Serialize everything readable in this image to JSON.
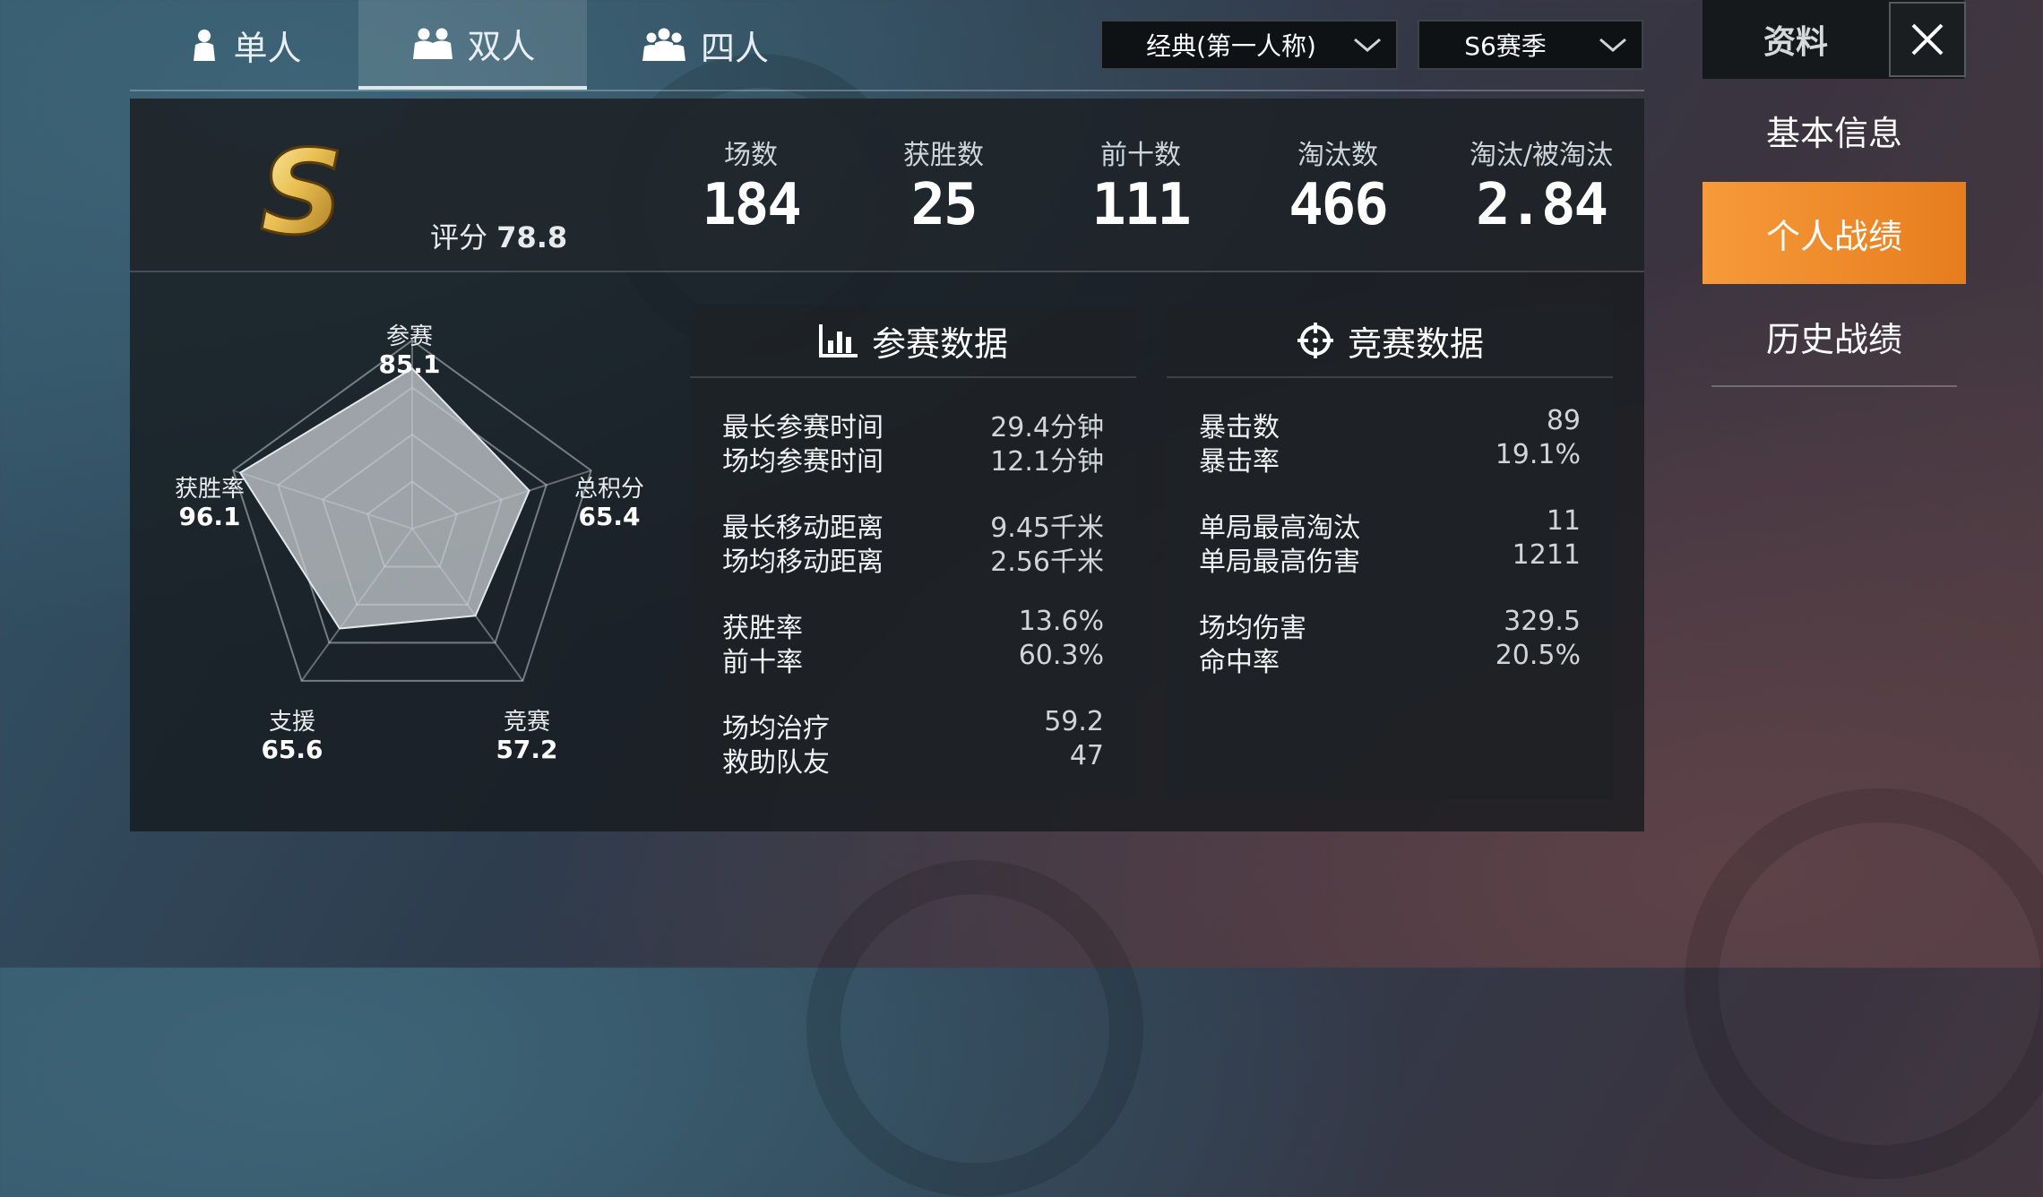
{
  "tabs": [
    {
      "label": "单人",
      "icon": "single-person-icon"
    },
    {
      "label": "双人",
      "icon": "duo-icon",
      "active": true
    },
    {
      "label": "四人",
      "icon": "squad-icon"
    }
  ],
  "filters": {
    "mode": "经典(第一人称)",
    "season": "S6赛季"
  },
  "right_panel": {
    "title": "资料",
    "nav": [
      "基本信息",
      "个人战绩",
      "历史战绩"
    ],
    "active_index": 1,
    "accent": "#f08a2c"
  },
  "summary": {
    "rank_letter": "S",
    "rating_label": "评分",
    "rating_value": "78.8",
    "stats": [
      {
        "label": "场数",
        "value": "184"
      },
      {
        "label": "获胜数",
        "value": "25"
      },
      {
        "label": "前十数",
        "value": "111"
      },
      {
        "label": "淘汰数",
        "value": "466"
      },
      {
        "label": "淘汰/被淘汰",
        "value": "2.84"
      }
    ]
  },
  "radar": {
    "axes": [
      {
        "label": "参赛",
        "value": "85.1",
        "score": 85.1
      },
      {
        "label": "总积分",
        "value": "65.4",
        "score": 65.4
      },
      {
        "label": "竞赛",
        "value": "57.2",
        "score": 57.2
      },
      {
        "label": "支援",
        "value": "65.6",
        "score": 65.6
      },
      {
        "label": "获胜率",
        "value": "96.1",
        "score": 96.1
      }
    ]
  },
  "participation": {
    "title": "参赛数据",
    "icon": "bar-chart-icon",
    "groups": [
      [
        {
          "k": "最长参赛时间",
          "v": "29.4分钟"
        },
        {
          "k": "场均参赛时间",
          "v": "12.1分钟"
        }
      ],
      [
        {
          "k": "最长移动距离",
          "v": "9.45千米"
        },
        {
          "k": "场均移动距离",
          "v": "2.56千米"
        }
      ],
      [
        {
          "k": "获胜率",
          "v": "13.6%"
        },
        {
          "k": "前十率",
          "v": "60.3%"
        }
      ],
      [
        {
          "k": "场均治疗",
          "v": "59.2"
        },
        {
          "k": "救助队友",
          "v": "47"
        }
      ]
    ]
  },
  "combat": {
    "title": "竞赛数据",
    "icon": "crosshair-icon",
    "groups": [
      [
        {
          "k": "暴击数",
          "v": "89"
        },
        {
          "k": "暴击率",
          "v": "19.1%"
        }
      ],
      [
        {
          "k": "单局最高淘汰",
          "v": "11"
        },
        {
          "k": "单局最高伤害",
          "v": "1211"
        }
      ],
      [
        {
          "k": "场均伤害",
          "v": "329.5"
        },
        {
          "k": "命中率",
          "v": "20.5%"
        }
      ]
    ]
  }
}
